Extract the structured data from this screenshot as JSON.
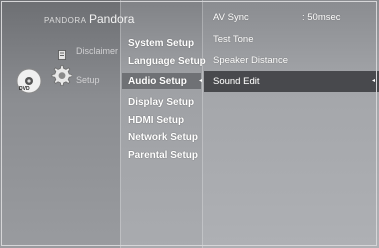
{
  "left_panel": {
    "pandora_prefix": "PANDORA",
    "pandora_label": "Pandora",
    "disclaimer_label": "Disclaimer",
    "setup_label": "Setup",
    "disc_icon_label": "DVD"
  },
  "setup_menu": {
    "items": [
      {
        "label": "System Setup"
      },
      {
        "label": "Language Setup"
      },
      {
        "label": "Audio Setup"
      },
      {
        "label": "Display Setup"
      },
      {
        "label": "HDMI Setup"
      },
      {
        "label": "Network Setup"
      },
      {
        "label": "Parental Setup"
      }
    ],
    "selected_index": 2
  },
  "audio_submenu": {
    "items": [
      {
        "label": "AV Sync",
        "value": ": 50msec"
      },
      {
        "label": "Test Tone",
        "value": ""
      },
      {
        "label": "Speaker Distance",
        "value": ""
      },
      {
        "label": "Sound Edit",
        "value": ""
      }
    ],
    "selected_index": 3
  },
  "colors": {
    "highlight": "#48494d",
    "text": "#ffffff"
  }
}
